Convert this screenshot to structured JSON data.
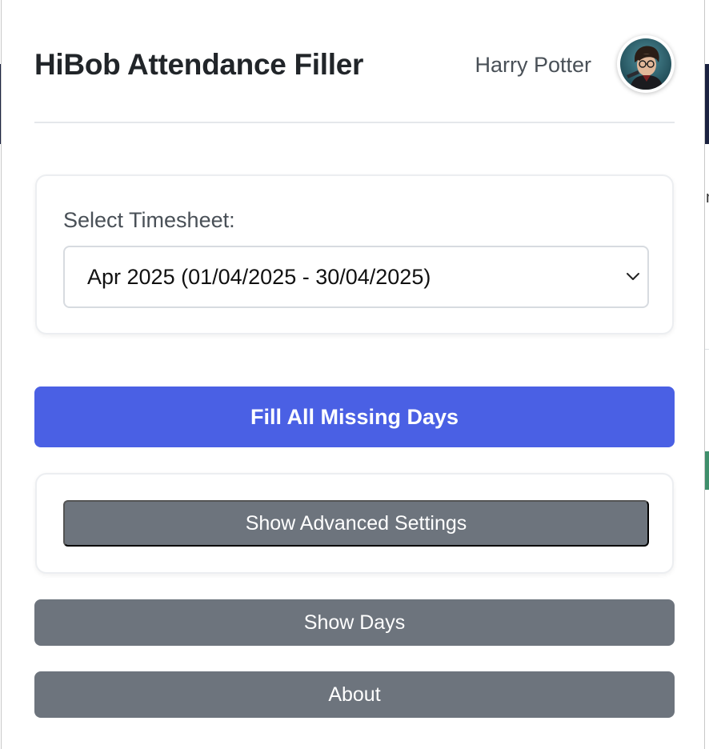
{
  "header": {
    "title": "HiBob Attendance Filler",
    "user_name": "Harry Potter"
  },
  "timesheet": {
    "label": "Select Timesheet:",
    "selected": "Apr 2025 (01/04/2025 - 30/04/2025)"
  },
  "actions": {
    "fill_all": "Fill All Missing Days",
    "advanced": "Show Advanced Settings",
    "show_days": "Show Days",
    "about": "About"
  },
  "colors": {
    "primary": "#4a60e4",
    "secondary": "#6d747d"
  },
  "icons": {
    "avatar": "user-avatar",
    "select_arrow": "chevron-down-icon"
  }
}
